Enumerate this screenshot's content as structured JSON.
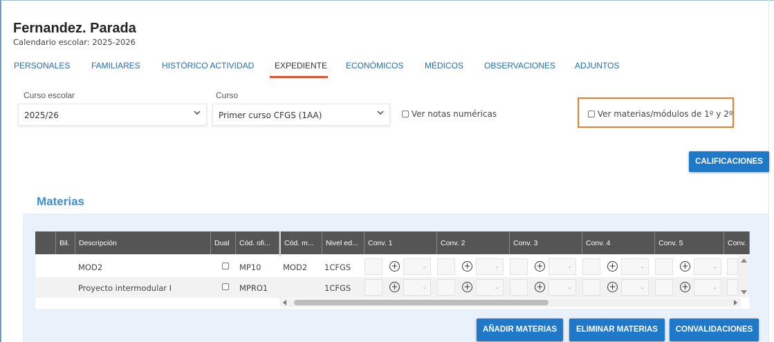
{
  "header": {
    "student_name": "Fernandez. Parada",
    "calendar": "Calendario escolar: 2025-2026"
  },
  "tabs": [
    {
      "label": "PERSONALES"
    },
    {
      "label": "FAMILIARES"
    },
    {
      "label": "HISTÓRICO ACTIVIDAD"
    },
    {
      "label": "EXPEDIENTE",
      "active": true
    },
    {
      "label": "ECONÓMICOS"
    },
    {
      "label": "MÉDICOS"
    },
    {
      "label": "OBSERVACIONES"
    },
    {
      "label": "ADJUNTOS"
    }
  ],
  "filters": {
    "curso_escolar_label": "Curso escolar",
    "curso_escolar_value": "2025/26",
    "curso_label": "Curso",
    "curso_value": "Primer curso CFGS (1AA)",
    "ver_notas_label": "Ver notas numéricas",
    "ver_materias_label": "Ver materias/módulos de 1º y 2º"
  },
  "buttons": {
    "calificaciones": "CALIFICACIONES",
    "anadir": "AÑADIR MATERIAS",
    "eliminar": "ELIMINAR MATERIAS",
    "convalidaciones": "CONVALIDACIONES"
  },
  "materias": {
    "title": "Materias",
    "columns": [
      "Bil.",
      "Descripción",
      "Dual",
      "Cód. ofi...",
      "Cód. m...",
      "Nivel ed...",
      "Conv. 1",
      "Conv. 2",
      "Conv. 3",
      "Conv. 4",
      "Conv. 5",
      "Conv."
    ],
    "rows": [
      {
        "descripcion": "MOD2",
        "cod_oficial": "MP10",
        "cod_materia": "MOD2",
        "nivel": "1CFGS"
      },
      {
        "descripcion": "Proyecto intermodular I",
        "cod_oficial": "MPRO1",
        "cod_materia": "",
        "nivel": "1CFGS"
      }
    ]
  },
  "colors": {
    "link_blue": "#1f6db4",
    "button_blue": "#1f78c8",
    "active_underline": "#e1502f",
    "highlight_orange": "#f07b22",
    "header_dark": "#555555"
  }
}
